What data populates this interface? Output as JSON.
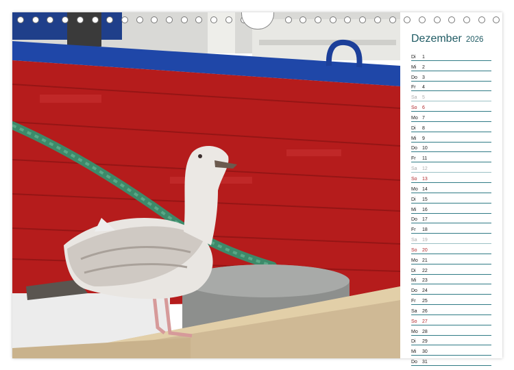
{
  "calendar": {
    "month": "Dezember",
    "year": "2026",
    "days": [
      {
        "dow": "Di",
        "day": "1",
        "type": "weekday"
      },
      {
        "dow": "Mi",
        "day": "2",
        "type": "weekday"
      },
      {
        "dow": "Do",
        "day": "3",
        "type": "weekday"
      },
      {
        "dow": "Fr",
        "day": "4",
        "type": "weekday"
      },
      {
        "dow": "Sa",
        "day": "5",
        "type": "saturday"
      },
      {
        "dow": "So",
        "day": "6",
        "type": "sunday"
      },
      {
        "dow": "Mo",
        "day": "7",
        "type": "weekday"
      },
      {
        "dow": "Di",
        "day": "8",
        "type": "weekday"
      },
      {
        "dow": "Mi",
        "day": "9",
        "type": "weekday"
      },
      {
        "dow": "Do",
        "day": "10",
        "type": "weekday"
      },
      {
        "dow": "Fr",
        "day": "11",
        "type": "weekday"
      },
      {
        "dow": "Sa",
        "day": "12",
        "type": "saturday"
      },
      {
        "dow": "So",
        "day": "13",
        "type": "sunday"
      },
      {
        "dow": "Mo",
        "day": "14",
        "type": "weekday"
      },
      {
        "dow": "Di",
        "day": "15",
        "type": "weekday"
      },
      {
        "dow": "Mi",
        "day": "16",
        "type": "weekday"
      },
      {
        "dow": "Do",
        "day": "17",
        "type": "weekday"
      },
      {
        "dow": "Fr",
        "day": "18",
        "type": "weekday"
      },
      {
        "dow": "Sa",
        "day": "19",
        "type": "saturday"
      },
      {
        "dow": "So",
        "day": "20",
        "type": "sunday"
      },
      {
        "dow": "Mo",
        "day": "21",
        "type": "weekday"
      },
      {
        "dow": "Di",
        "day": "22",
        "type": "weekday"
      },
      {
        "dow": "Mi",
        "day": "23",
        "type": "weekday"
      },
      {
        "dow": "Do",
        "day": "24",
        "type": "weekday"
      },
      {
        "dow": "Fr",
        "day": "25",
        "type": "weekday"
      },
      {
        "dow": "Sa",
        "day": "26",
        "type": "weekday"
      },
      {
        "dow": "So",
        "day": "27",
        "type": "sunday"
      },
      {
        "dow": "Mo",
        "day": "28",
        "type": "weekday"
      },
      {
        "dow": "Di",
        "day": "29",
        "type": "weekday"
      },
      {
        "dow": "Mi",
        "day": "30",
        "type": "weekday"
      },
      {
        "dow": "Do",
        "day": "31",
        "type": "weekday"
      }
    ]
  },
  "colors": {
    "accent": "#1e5a63",
    "sunday": "#b0262a",
    "saturday": "#aaaaaa",
    "boat_red": "#b51c1c",
    "boat_blue": "#1f47a8"
  },
  "photo_subject": "seagull-on-wooden-post-in-front-of-red-boat"
}
